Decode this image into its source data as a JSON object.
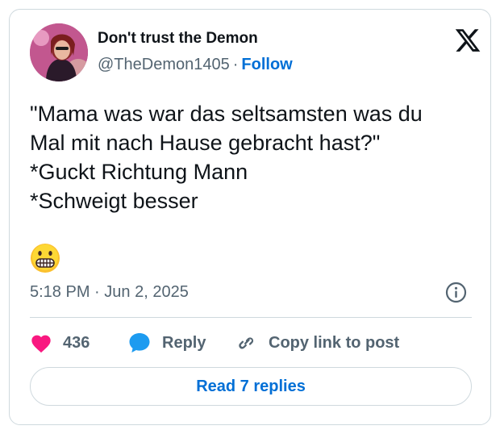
{
  "author": {
    "display_name": "Don't trust the Demon",
    "handle": "@TheDemon1405",
    "separator": "·",
    "follow_label": "Follow",
    "avatar_icon": "profile-photo"
  },
  "brand": {
    "logo_icon": "x-logo",
    "color": "#0f1419"
  },
  "tweet": {
    "lines": [
      "\"Mama was war das seltsamsten was du",
      "Mal mit nach Hause gebracht hast?\"",
      "*Guckt Richtung Mann",
      "*Schweigt besser"
    ],
    "emoji": "grimacing-face-emoji",
    "time": "5:18 PM",
    "meta_separator": "·",
    "date": "Jun 2, 2025"
  },
  "actions": {
    "like_count": "436",
    "like_icon": "heart-icon",
    "reply_label": "Reply",
    "reply_icon": "speech-bubble-icon",
    "copy_label": "Copy link to post",
    "copy_icon": "link-icon"
  },
  "footer": {
    "read_replies_label": "Read 7 replies"
  },
  "colors": {
    "accent": "#006fd6",
    "like": "#f91880",
    "reply": "#1d9bf0",
    "muted": "#536471",
    "border": "#cfd9de"
  }
}
